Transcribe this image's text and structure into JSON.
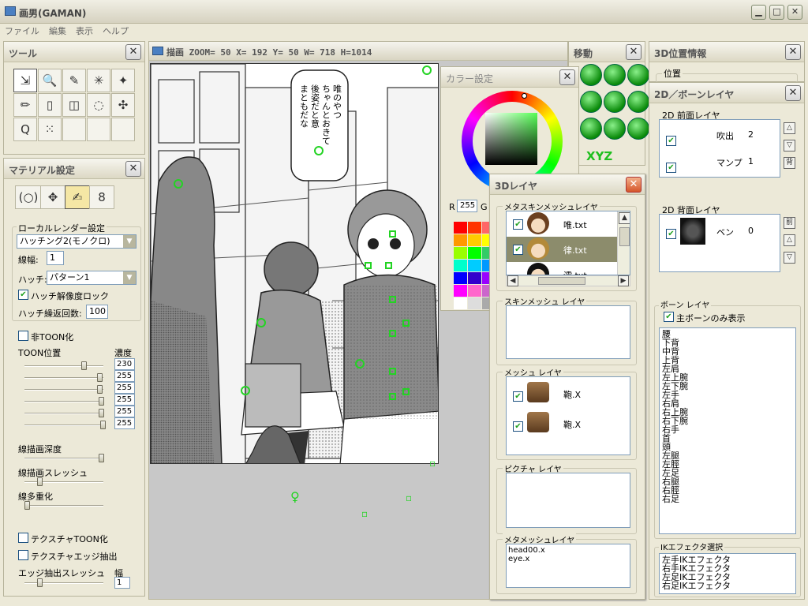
{
  "app": {
    "title": "画男(GAMAN)",
    "menu": [
      "ファイル",
      "編集",
      "表示",
      "ヘルプ"
    ]
  },
  "tools_panel": {
    "title": "ツール",
    "tools": [
      {
        "icon": "select-icon",
        "glyph": "⇲"
      },
      {
        "icon": "zoom-icon",
        "glyph": "🔍"
      },
      {
        "icon": "pen-icon",
        "glyph": "✎"
      },
      {
        "icon": "magic-wand-icon",
        "glyph": "✳"
      },
      {
        "icon": "pose-icon",
        "glyph": "✦"
      },
      {
        "icon": "pencil-icon",
        "glyph": "✏"
      },
      {
        "icon": "book-icon",
        "glyph": "▯"
      },
      {
        "icon": "cube-3d-icon",
        "glyph": "◫"
      },
      {
        "icon": "dotted-circle-icon",
        "glyph": "◌"
      },
      {
        "icon": "shrink-icon",
        "glyph": "✣"
      },
      {
        "icon": "lasso-icon",
        "glyph": "Q"
      },
      {
        "icon": "spray-icon",
        "glyph": "⁙"
      }
    ]
  },
  "material_panel": {
    "title": "マテリアル設定",
    "tabs": [
      {
        "icon": "face-icon",
        "glyph": "(○)"
      },
      {
        "icon": "figure-icon",
        "glyph": "✥"
      },
      {
        "icon": "render-icon",
        "glyph": "✍"
      },
      {
        "icon": "chain-icon",
        "glyph": "8"
      }
    ],
    "group_label": "ローカルレンダー設定",
    "render_mode": "ハッチング2(モノクロ)",
    "line_width_label": "線幅:",
    "line_width": "1",
    "hatch_label": "ハッチ:",
    "hatch_value": "パターン1",
    "hatch_lock_label": "ハッチ解像度ロック",
    "hatch_repeat_label": "ハッチ繰返回数:",
    "hatch_repeat": "100",
    "non_toon_label": "非TOON化",
    "toon_pos_label": "TOON位置",
    "density_label": "濃度",
    "toon_values": [
      "230",
      "255",
      "255",
      "255",
      "255",
      "255"
    ],
    "line_depth_label": "線描画深度",
    "line_threshold_label": "線描画スレッシュ",
    "line_multi_label": "線多重化",
    "tex_toon_label": "テクスチャTOON化",
    "tex_edge_label": "テクスチャエッジ抽出",
    "edge_threshold_label": "エッジ抽出スレッシュ",
    "width_label": "幅",
    "width_value": "1"
  },
  "canvas_window": {
    "title": "描画 ZOOM= 50 X= 192 Y=  50 W= 718 H=1014",
    "speech_text": "唯のやつ ちゃんとおきて 後姿だと意 まともだな"
  },
  "move_panel": {
    "title": "移動",
    "xyz_label": "XYZ"
  },
  "color_panel": {
    "title": "カラー設定",
    "r_label": "R",
    "r_value": "255",
    "g_label": "G",
    "palette": [
      "#ff0000",
      "#ff3300",
      "#ff6666",
      "#ff9900",
      "#ffcc00",
      "#ffff00",
      "#99ff00",
      "#00ff00",
      "#33cc66",
      "#00ffcc",
      "#00ccff",
      "#0099ff",
      "#0000ff",
      "#3300cc",
      "#9900ff",
      "#ff00ff",
      "#ff66cc",
      "#cc66cc",
      "#ffffff",
      "#dddddd",
      "#aaaaaa"
    ]
  },
  "layer3d_panel": {
    "title": "3Dレイヤ",
    "meta_skin_label": "メタスキンメッシュレイヤ",
    "meta_skin_items": [
      "唯.txt",
      "律.txt",
      "澪.txt"
    ],
    "skin_mesh_label": "スキンメッシュ レイヤ",
    "mesh_label": "メッシュ レイヤ",
    "mesh_items": [
      "鞄.X",
      "鞄.X"
    ],
    "picture_label": "ピクチャ レイヤ",
    "meta_mesh_label": "メタメッシュレイヤ",
    "meta_mesh_items": [
      "head00.x",
      "eye.x"
    ]
  },
  "pos3d_panel": {
    "title": "3D位置情報",
    "position_label": "位置"
  },
  "bone2d_panel": {
    "title": "2D／ボーンレイヤ",
    "front_label": "2D 前面レイヤ",
    "front_items": [
      {
        "name": "吹出",
        "num": "2"
      },
      {
        "name": "マンプ",
        "num": "1"
      }
    ],
    "front_btn_back": "背",
    "back_label": "2D 背面レイヤ",
    "back_items": [
      {
        "name": "ベン",
        "num": "0"
      }
    ],
    "back_btn_front": "前",
    "bone_label": "ボーン レイヤ",
    "main_bone_only": "主ボーンのみ表示",
    "bones": [
      "腰",
      "下背",
      "中背",
      "上背",
      "左肩",
      "左上腕",
      "左下腕",
      "左手",
      "右肩",
      "右上腕",
      "右下腕",
      "右手",
      "首",
      "頭",
      "左腿",
      "左脛",
      "左足",
      "右腿",
      "右脛",
      "右足"
    ],
    "ik_label": "IKエフェクタ選択",
    "ik_items": [
      "左手IKエフェクタ",
      "右手IKエフェクタ",
      "左足IKエフェクタ",
      "右足IKエフェクタ"
    ]
  }
}
